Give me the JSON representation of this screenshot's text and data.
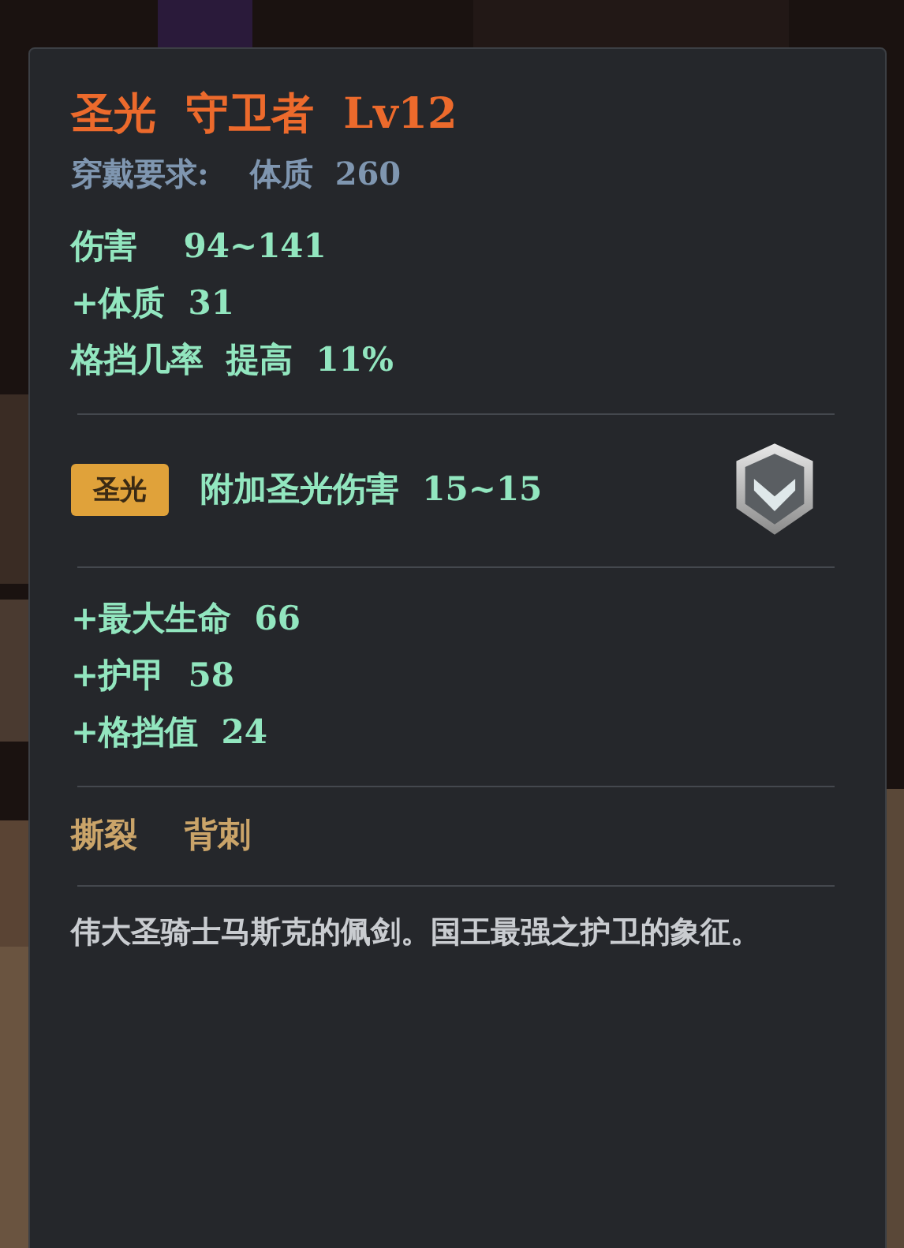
{
  "item": {
    "title": "圣光  守卫者  Lv12",
    "requirement": {
      "label": "穿戴要求:",
      "value": "体质  260"
    },
    "base_stats": [
      "伤害    94~141",
      "+体质  31",
      "格挡几率  提高  11%"
    ],
    "enchant": {
      "tag": "圣光",
      "text": "附加圣光伤害  15~15"
    },
    "bonus_stats": [
      "+最大生命  66",
      "+护甲  58",
      "+格挡值  24"
    ],
    "skills": [
      "撕裂",
      "背刺"
    ],
    "description": "伟大圣骑士马斯克的佩剑。国王最强之护卫的象征。"
  }
}
